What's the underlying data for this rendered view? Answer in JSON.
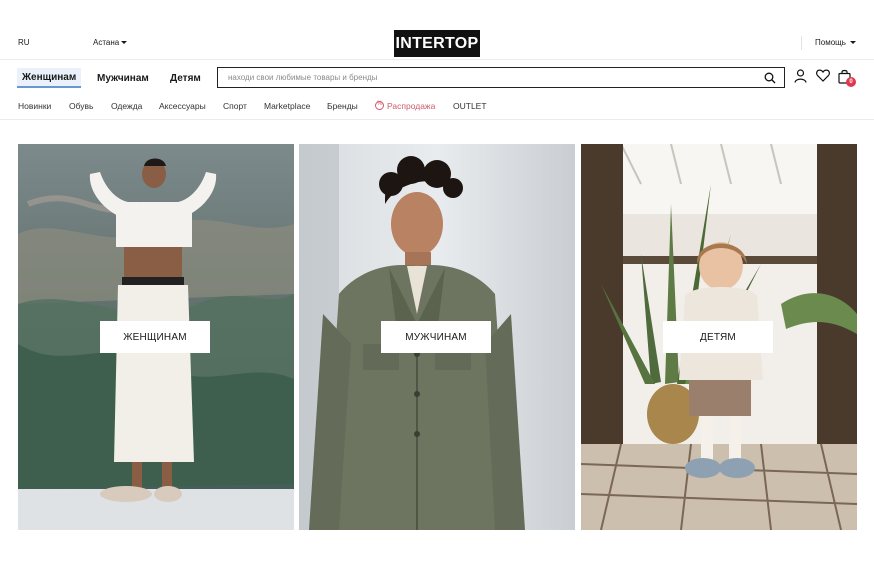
{
  "header": {
    "lang": "RU",
    "city": "Астана",
    "logo": "INTERTOP",
    "help": "Помощь"
  },
  "nav": {
    "categories": [
      "Женщинам",
      "Мужчинам",
      "Детям"
    ],
    "active_category": "Женщинам",
    "search_placeholder": "находи свои любимые товары и бренды",
    "cart_count": "0"
  },
  "subnav": {
    "items": [
      "Новинки",
      "Обувь",
      "Одежда",
      "Аксессуары",
      "Спорт",
      "Marketplace",
      "Бренды",
      "Распродажа",
      "OUTLET"
    ]
  },
  "tiles": [
    {
      "label": "ЖЕНЩИНАМ"
    },
    {
      "label": "МУЖЧИНАМ"
    },
    {
      "label": "ДЕТЯМ"
    }
  ],
  "colors": {
    "active_tab_bg": "#ebf1fa",
    "active_tab_underline": "#6a96d6",
    "sale": "#d05a6c",
    "badge": "#e0394f",
    "logo_bg": "#111111"
  },
  "icons": [
    "search-icon",
    "user-icon",
    "heart-icon",
    "bag-icon",
    "sale-icon",
    "caret-down-icon"
  ]
}
